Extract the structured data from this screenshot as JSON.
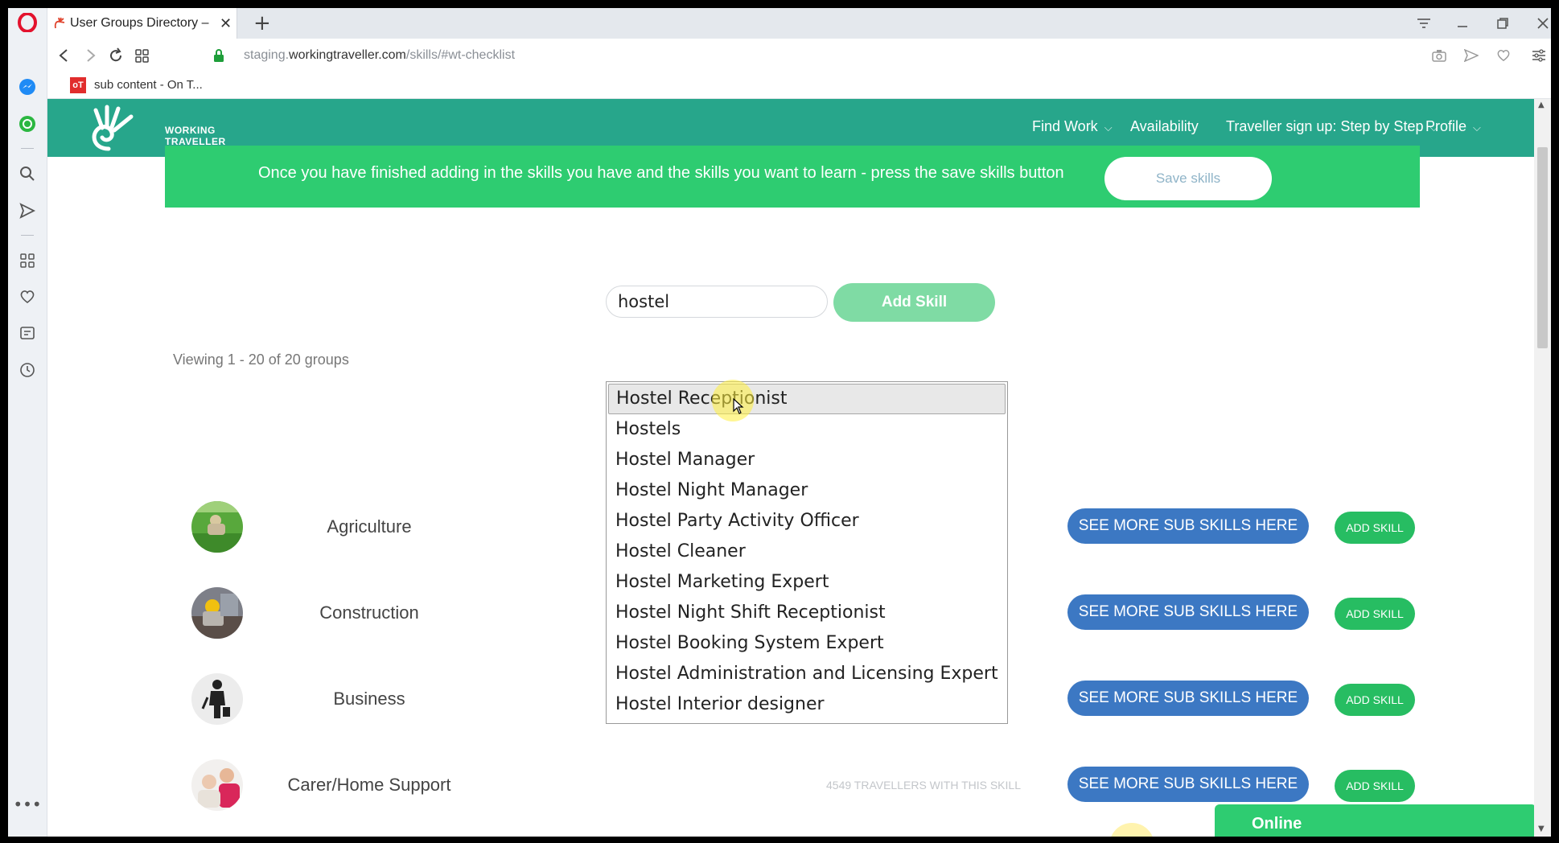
{
  "browser": {
    "tab_title": "User Groups Directory – W",
    "url_prefix": "staging.",
    "url_host": "workingtraveller.com",
    "url_path": "/skills/#wt-checklist",
    "bookmark_label": "sub content - On T...",
    "bookmark_icon_text": "oT"
  },
  "header": {
    "logo_line1": "WORKING",
    "logo_line2": "TRAVELLER",
    "nav": {
      "find_work": "Find Work",
      "availability": "Availability",
      "signup": "Traveller sign up: Step by Step",
      "profile": "Profile"
    }
  },
  "banner": {
    "text": "Once you have finished adding in the skills you have and the skills you want to learn - press the save skills button",
    "save_label": "Save skills"
  },
  "search": {
    "value": "hostel",
    "add_label": "Add Skill"
  },
  "viewing": "Viewing 1 - 20 of 20 groups",
  "autocomplete": [
    "Hostel Receptionist",
    "Hostels",
    "Hostel Manager",
    "Hostel Night Manager",
    "Hostel Party Activity Officer",
    "Hostel Cleaner",
    "Hostel Marketing Expert",
    "Hostel Night Shift Receptionist",
    "Hostel Booking System Expert",
    "Hostel Administration and Licensing Expert",
    "Hostel Interior designer"
  ],
  "categories": [
    {
      "name": "Agriculture",
      "count": "",
      "see_more": "SEE MORE SUB SKILLS HERE",
      "add": "ADD SKILL"
    },
    {
      "name": "Construction",
      "count": "",
      "see_more": "SEE MORE SUB SKILLS HERE",
      "add": "ADD SKILL"
    },
    {
      "name": "Business",
      "count": "",
      "see_more": "SEE MORE SUB SKILLS HERE",
      "add": "ADD SKILL"
    },
    {
      "name": "Carer/Home Support",
      "count": "4549 TRAVELLERS WITH THIS SKILL",
      "see_more": "SEE MORE SUB SKILLS HERE",
      "add": "ADD SKILL"
    }
  ],
  "chat": {
    "label": "Online"
  },
  "colors": {
    "header_bg": "#27a68b",
    "banner_bg": "#2ecc71",
    "see_more_blue": "#3c78c3",
    "add_skill_green": "#27bd62"
  }
}
